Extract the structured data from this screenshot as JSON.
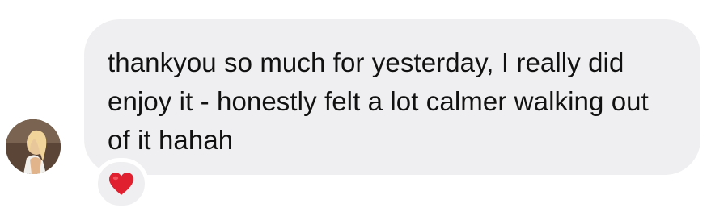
{
  "message": {
    "text": "thankyou so much for yesterday, I really did enjoy it - honestly felt a lot calmer walking out of it hahah",
    "reaction_icon": "red-heart-icon"
  },
  "colors": {
    "bubble_background": "#efeff1",
    "text": "#111111",
    "heart": "#e0202f"
  }
}
